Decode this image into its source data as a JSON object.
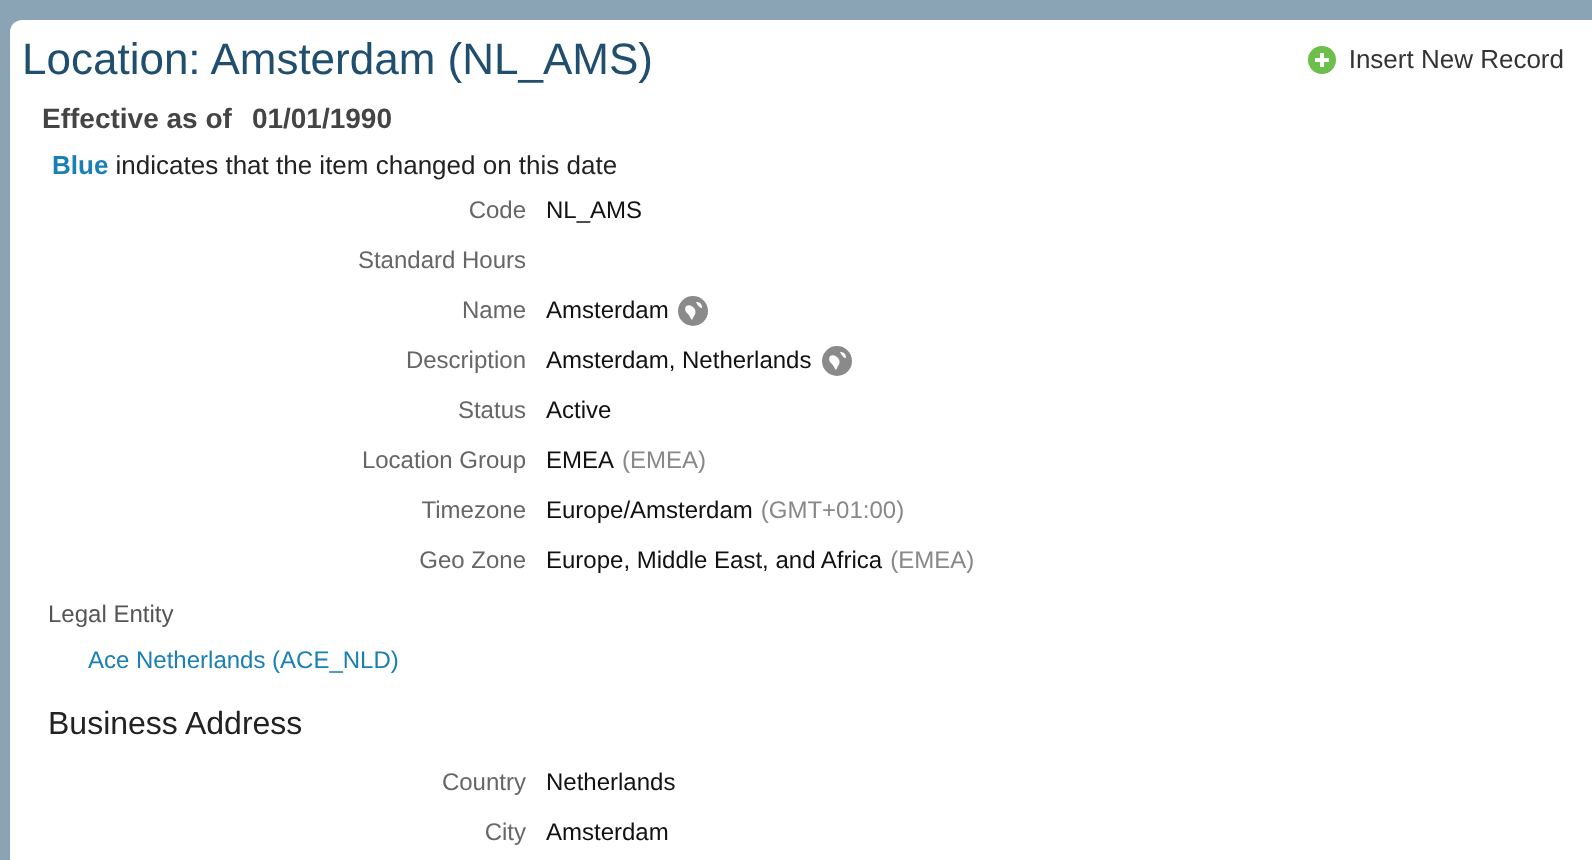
{
  "title": "Location: Amsterdam (NL_AMS)",
  "insert_action": {
    "label": "Insert New Record"
  },
  "effective": {
    "label": "Effective as of",
    "date": "01/01/1990"
  },
  "legend": "**Blue** indicates that the item changed on this date",
  "fields": [
    {
      "label": "Code",
      "value": "NL_AMS",
      "translatable": false
    },
    {
      "label": "Standard Hours",
      "translatable": false
    },
    {
      "label": "Name",
      "value": "Amsterdam",
      "translatable": true
    },
    {
      "label": "Description",
      "value": "Amsterdam, Netherlands",
      "translatable": true
    },
    {
      "label": "Status",
      "value": "Active",
      "translatable": false
    },
    {
      "label": "Location Group",
      "value": "EMEA",
      "note": "(EMEA)",
      "translatable": false
    },
    {
      "label": "Timezone",
      "value": "Europe/Amsterdam",
      "note": "(GMT+01:00)",
      "translatable": false
    },
    {
      "label": "Geo Zone",
      "value": "Europe, Middle East, and Africa",
      "note": "(EMEA)",
      "translatable": false
    }
  ],
  "legal_entity": {
    "label": "Legal Entity",
    "link": "Ace Netherlands (ACE_NLD)"
  },
  "business_address": {
    "heading": "Business Address",
    "fields": [
      {
        "label": "Country",
        "value": "Netherlands",
        "translatable": false
      },
      {
        "label": "City",
        "value": "Amsterdam",
        "translatable": false
      }
    ]
  }
}
